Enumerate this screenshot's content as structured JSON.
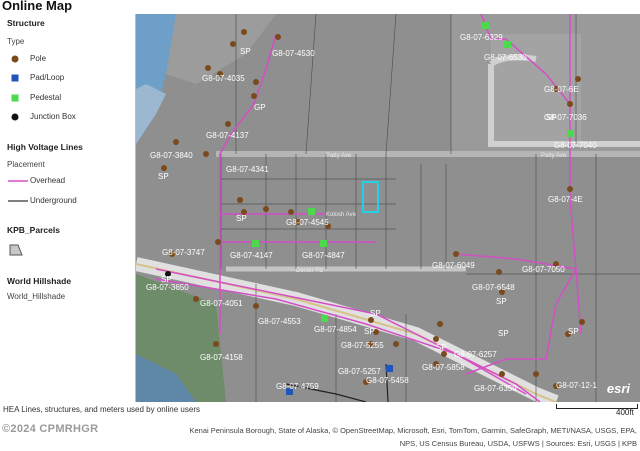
{
  "title": "Online Map",
  "legend": {
    "structure_heading": "Structure",
    "type_label": "Type",
    "structure_items": [
      {
        "label": "Pole",
        "color": "#7a4a1c",
        "icon": "pole-dot"
      },
      {
        "label": "Pad/Loop",
        "color": "#1f56b8",
        "icon": "pad-square"
      },
      {
        "label": "Pedestal",
        "color": "#4cd94c",
        "icon": "pedestal-square"
      },
      {
        "label": "Junction Box",
        "color": "#111111",
        "icon": "junction-dot"
      }
    ],
    "hv_heading": "High Voltage Lines",
    "placement_label": "Placement",
    "hv_items": [
      {
        "label": "Overhead",
        "color": "#d44fc6"
      },
      {
        "label": "Underground",
        "color": "#333333"
      }
    ],
    "parcels_heading": "KPB_Parcels",
    "hillshade_heading": "World Hillshade",
    "hillshade_item": "World_Hillshade"
  },
  "map": {
    "esri_logo": "esri",
    "sp_label": "SP",
    "gp_label": "GP",
    "line_color": "#d44fc6",
    "pole_color": "#7a4a1c",
    "pedestal_color": "#4cd94c",
    "pad_color": "#1f56b8",
    "roads": [
      "Patty Ave",
      "Patty Ave",
      "Kolosh Ave",
      "Dexter Rd"
    ],
    "labels": [
      "G8-07-4530",
      "G8-07-4035",
      "G8-07-4137",
      "G8-07-3840",
      "G8-07-4341",
      "G8-07-4545",
      "G8-07-3747",
      "G8-07-4147",
      "G8-07-4847",
      "G8-07-3650",
      "G8-07-4051",
      "G8-07-4553",
      "G8-07-4854",
      "G8-07-4158",
      "G8-07-5255",
      "G8-07-5257",
      "G8-07-5458",
      "G8-07-4759",
      "G8-07-6049",
      "G8-07-6548",
      "G8-07-5858",
      "G8-07-6257",
      "G8-07-6359",
      "G8-07-7050",
      "G8-07-4E",
      "G8-07-6329",
      "G8-07-6530",
      "G8-07-6E",
      "G8-07-7036",
      "G8-07-7040",
      "G8-07-12-1"
    ]
  },
  "footer": {
    "description": "HEA Lines, structures, and meters used by online users",
    "scale_label": "400ft",
    "attribution_line1": "Kenai Peninsula Borough, State of Alaska, © OpenStreetMap, Microsoft, Esri, TomTom, Garmin, SafeGraph, METI/NASA, USGS, EPA,",
    "attribution_line2": "NPS, US Census Bureau, USDA, USFWS | Sources: Esri, USGS | KPB",
    "copyright": "©2024 CPMRHGR"
  }
}
